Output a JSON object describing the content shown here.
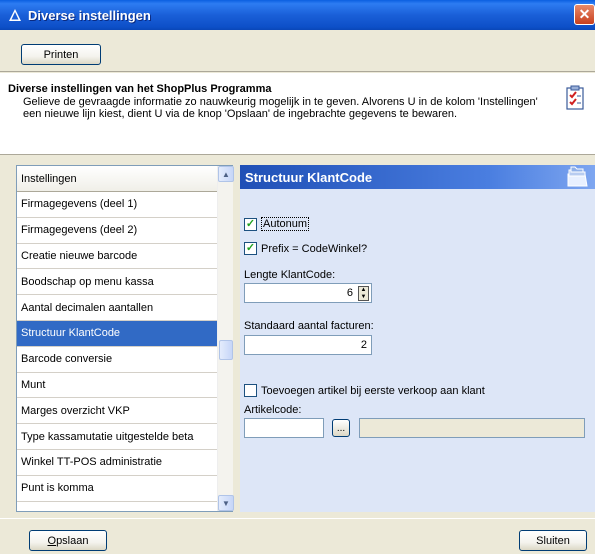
{
  "window": {
    "title": "Diverse instellingen",
    "close_glyph": "✕"
  },
  "toolbar": {
    "print_label": "Printen"
  },
  "header": {
    "title": "Diverse instellingen van het ShopPlus Programma",
    "description": "Gelieve de gevraagde informatie zo nauwkeurig mogelijk in te geven. Alvorens U in de kolom 'Instellingen' een nieuwe lijn kiest, dient U via de knop 'Opslaan' de ingebrachte gegevens te bewaren.",
    "icon": "checklist-icon"
  },
  "settings_list": {
    "header": "Instellingen",
    "selected_index": 6,
    "items": [
      "Firmagegevens (deel 1)",
      "Firmagegevens (deel 2)",
      "Creatie nieuwe barcode",
      "Boodschap op menu kassa",
      "Aantal decimalen aantallen",
      "Structuur KlantCode",
      "Barcode conversie",
      "Munt",
      "Marges overzicht VKP",
      "Type kassamutatie uitgestelde beta",
      "Winkel TT-POS administratie",
      "Punt is komma"
    ]
  },
  "detail": {
    "title": "Structuur KlantCode",
    "icon": "folder-stack-icon",
    "autonum": {
      "label": "Autonum",
      "checked": true
    },
    "prefix": {
      "label": "Prefix = CodeWinkel?",
      "checked": true
    },
    "length": {
      "label": "Lengte KlantCode:",
      "value": "6"
    },
    "invoices": {
      "label": "Standaard aantal facturen:",
      "value": "2"
    },
    "add_article": {
      "label": "Toevoegen artikel bij eerste verkoop aan klant",
      "checked": false
    },
    "article_code": {
      "label": "Artikelcode:",
      "value": "",
      "description": "",
      "browse_label": "..."
    }
  },
  "footer": {
    "save_label": "Opslaan",
    "save_mnemonic": "O",
    "save_rest": "pslaan",
    "close_label": "Sluiten"
  },
  "colors": {
    "titlebar": "#0A5FE0",
    "selection": "#316AC5",
    "section_header": "#1F4FB6",
    "panel_bg": "#DDE6F7",
    "check": "#21A121"
  }
}
